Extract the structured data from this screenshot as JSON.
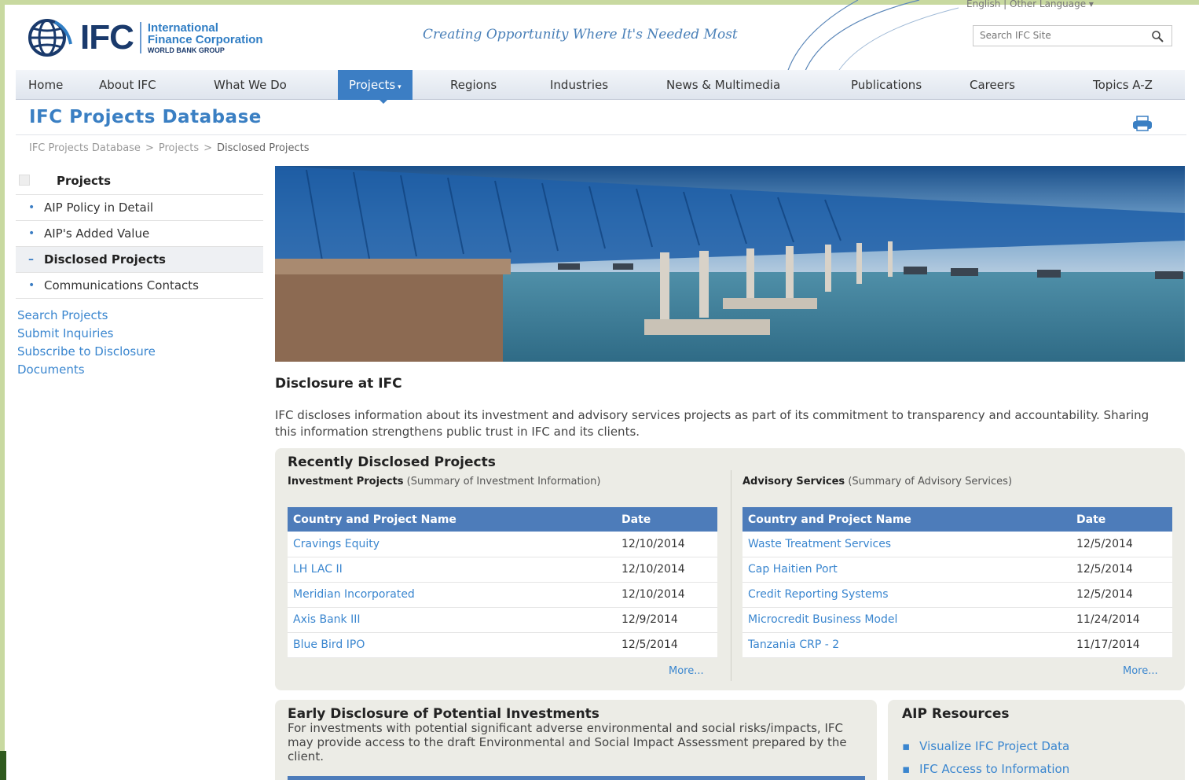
{
  "header": {
    "logo_mark": "IFC",
    "logo_line1": "International",
    "logo_line2": "Finance Corporation",
    "logo_line3": "WORLD BANK GROUP",
    "tagline": "Creating Opportunity Where It's Needed Most",
    "language": "English | Other Language ▾",
    "search_placeholder": "Search IFC Site"
  },
  "nav": {
    "items": [
      "Home",
      "About IFC",
      "What We Do",
      "Projects",
      "Regions",
      "Industries",
      "News & Multimedia",
      "Publications",
      "Careers",
      "Topics A-Z"
    ],
    "active_caret": "▾"
  },
  "page": {
    "title": "IFC Projects Database",
    "breadcrumb": [
      "IFC Projects Database",
      "Projects",
      "Disclosed Projects"
    ],
    "breadcrumb_sep": ">"
  },
  "sidebar": {
    "heading": "Projects",
    "items": [
      "AIP Policy in Detail",
      "AIP's Added Value",
      "Disclosed Projects",
      "Communications Contacts"
    ],
    "links": [
      "Search Projects",
      "Submit Inquiries",
      "Subscribe to Disclosure",
      "Documents"
    ]
  },
  "disclosure": {
    "heading": "Disclosure at IFC",
    "text": "IFC discloses information about its investment and advisory services projects as part of its commitment to transparency and accountability. Sharing this information strengthens public trust in IFC and its clients."
  },
  "recent": {
    "title": "Recently Disclosed Projects",
    "investment": {
      "label": "Investment Projects",
      "note": "(Summary of Investment Information)",
      "col_name": "Country and Project Name",
      "col_date": "Date",
      "rows": [
        {
          "name": "Cravings Equity",
          "date": "12/10/2014"
        },
        {
          "name": "LH LAC II",
          "date": "12/10/2014"
        },
        {
          "name": "Meridian Incorporated",
          "date": "12/10/2014"
        },
        {
          "name": "Axis Bank III",
          "date": "12/9/2014"
        },
        {
          "name": "Blue Bird IPO",
          "date": "12/5/2014"
        }
      ],
      "more": "More..."
    },
    "advisory": {
      "label": "Advisory Services",
      "note": "(Summary of Advisory Services)",
      "col_name": "Country and Project Name",
      "col_date": "Date",
      "rows": [
        {
          "name": "Waste Treatment Services",
          "date": "12/5/2014"
        },
        {
          "name": "Cap Haitien Port",
          "date": "12/5/2014"
        },
        {
          "name": "Credit Reporting Systems",
          "date": "12/5/2014"
        },
        {
          "name": "Microcredit Business Model",
          "date": "11/24/2014"
        },
        {
          "name": "Tanzania CRP - 2",
          "date": "11/17/2014"
        }
      ],
      "more": "More..."
    }
  },
  "early": {
    "title": "Early Disclosure of Potential Investments",
    "text": "For investments with potential significant adverse environmental and social risks/impacts, IFC may provide access to the draft Environmental and Social Impact Assessment prepared by the client."
  },
  "aip": {
    "title": "AIP Resources",
    "items": [
      "Visualize IFC Project Data",
      "IFC Access to Information"
    ]
  },
  "colors": {
    "accent": "#3c7ec4",
    "link": "#3a86cf",
    "table_header": "#4d7cba",
    "panel_bg": "#ecece6"
  }
}
